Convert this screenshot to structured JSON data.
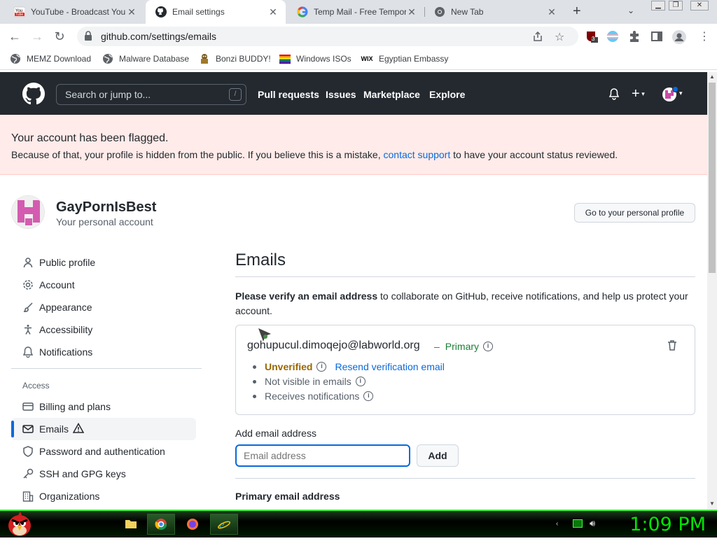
{
  "browser": {
    "tabs": [
      {
        "title": "YouTube - Broadcast Yourself",
        "icon": "youtube-icon"
      },
      {
        "title": "Email settings",
        "icon": "github-icon"
      },
      {
        "title": "Temp Mail - Free Temporary",
        "icon": "google-icon"
      },
      {
        "title": "New Tab",
        "icon": "chrome-icon"
      }
    ],
    "url": "github.com/settings/emails",
    "extension_badge": "3",
    "bookmarks": [
      {
        "label": "MEMZ Download",
        "icon": "globe-icon"
      },
      {
        "label": "Malware Database",
        "icon": "globe-icon"
      },
      {
        "label": "Bonzi BUDDY!",
        "icon": "bonzi-icon"
      },
      {
        "label": "Windows ISOs",
        "icon": "windows-icon"
      },
      {
        "label": "Egyptian Embassy",
        "icon": "wix-icon"
      }
    ],
    "wix_text": "WIX"
  },
  "github_header": {
    "search_placeholder": "Search or jump to...",
    "search_shortcut": "/",
    "nav": [
      "Pull requests",
      "Issues",
      "Marketplace",
      "Explore"
    ]
  },
  "flag_banner": {
    "title": "Your account has been flagged.",
    "text_before": "Because of that, your profile is hidden from the public. If you believe this is a mistake, ",
    "link": "contact support",
    "text_after": " to have your account status reviewed."
  },
  "profile": {
    "username": "GayPornIsBest",
    "subtitle": "Your personal account",
    "button": "Go to your personal profile"
  },
  "sidebar": {
    "items": [
      {
        "label": "Public profile",
        "icon": "person-icon"
      },
      {
        "label": "Account",
        "icon": "gear-icon"
      },
      {
        "label": "Appearance",
        "icon": "paintbrush-icon"
      },
      {
        "label": "Accessibility",
        "icon": "accessibility-icon"
      },
      {
        "label": "Notifications",
        "icon": "bell-icon"
      }
    ],
    "section": "Access",
    "access_items": [
      {
        "label": "Billing and plans",
        "icon": "credit-card-icon"
      },
      {
        "label": "Emails",
        "icon": "mail-icon",
        "selected": true
      },
      {
        "label": "Password and authentication",
        "icon": "shield-icon"
      },
      {
        "label": "SSH and GPG keys",
        "icon": "key-icon"
      },
      {
        "label": "Organizations",
        "icon": "organization-icon"
      }
    ]
  },
  "main": {
    "title": "Emails",
    "verify_bold": "Please verify an email address",
    "verify_rest": " to collaborate on GitHub, receive notifications, and help us protect your account.",
    "email": {
      "address": "gohupucul.dimoqejo@labworld.org",
      "separator": "–",
      "primary": "Primary",
      "unverified": "Unverified",
      "resend": "Resend verification email",
      "not_visible": "Not visible in emails",
      "receives": "Receives notifications"
    },
    "add_label": "Add email address",
    "input_placeholder": "Email address",
    "add_button": "Add",
    "primary_label": "Primary email address"
  },
  "taskbar": {
    "clock": "1:09 PM"
  },
  "colors": {
    "header_bg": "#24292f",
    "flag_bg": "#ffebe9",
    "link": "#0969da",
    "verified_green": "#1a7f37",
    "unverified": "#9a6700",
    "clock_green": "#00e600"
  }
}
